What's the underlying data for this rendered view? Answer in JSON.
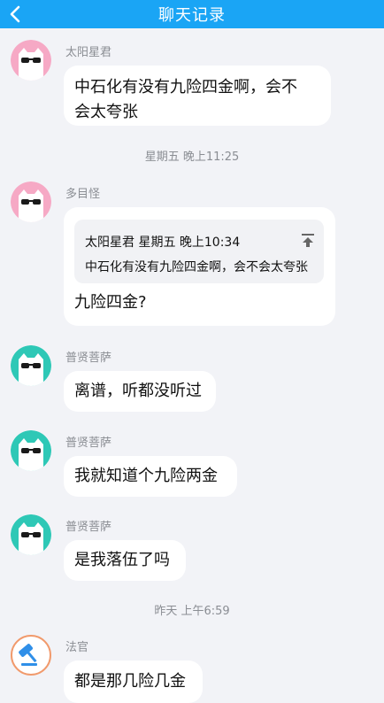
{
  "header": {
    "title": "聊天记录",
    "back_icon": "chevron-left-icon"
  },
  "colors": {
    "header_bg": "#1aa5f5",
    "page_bg": "#f2f3f7",
    "bubble_bg": "#ffffff"
  },
  "messages": [
    {
      "sender": "太阳星君",
      "avatar": "pink-cat-sunglasses-avatar",
      "lines": [
        "中石化有没有九险四金啊，会不",
        "会太夸张"
      ]
    },
    {
      "timestamp": "星期五 晚上11:25"
    },
    {
      "sender": "多目怪",
      "avatar": "pink-cat-sunglasses-avatar",
      "quote": {
        "header": "太阳星君  星期五 晚上10:34",
        "text": "中石化有没有九险四金啊，会不会太夸张",
        "icon": "jump-to-top-icon"
      },
      "lines": [
        "九险四金?"
      ]
    },
    {
      "sender": "普贤菩萨",
      "avatar": "teal-cat-sunglasses-avatar",
      "lines": [
        "离谱，听都没听过"
      ]
    },
    {
      "sender": "普贤菩萨",
      "avatar": "teal-cat-sunglasses-avatar",
      "lines": [
        "我就知道个九险两金"
      ]
    },
    {
      "sender": "普贤菩萨",
      "avatar": "teal-cat-sunglasses-avatar",
      "lines": [
        "是我落伍了吗"
      ]
    },
    {
      "timestamp": "昨天 上午6:59"
    },
    {
      "sender": "法官",
      "avatar": "gavel-avatar",
      "lines": [
        "都是那几险几金"
      ]
    }
  ]
}
